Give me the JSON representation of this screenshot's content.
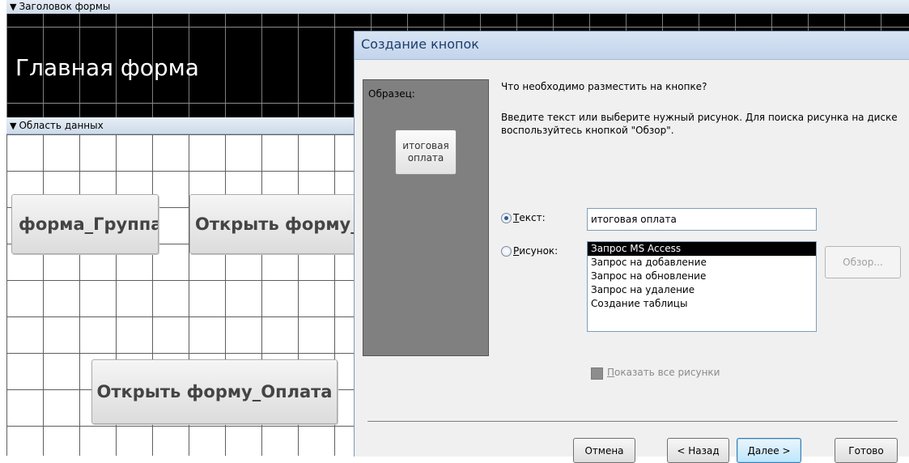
{
  "designer": {
    "header_section_label": "Заголовок формы",
    "form_title": "Главная форма",
    "detail_section_label": "Область данных",
    "buttons": [
      {
        "label": "форма_Группа"
      },
      {
        "label": "Открыть форму_С"
      },
      {
        "label": "Открыть форму_Оплата"
      }
    ]
  },
  "dialog": {
    "title": "Создание кнопок",
    "sample_label": "Образец:",
    "sample_button_label": "итоговая оплата",
    "question": "Что необходимо разместить на кнопке?",
    "instruction": "Введите текст или выберите нужный рисунок.  Для поиска рисунка на диске воспользуйтесь кнопкой \"Обзор\".",
    "text_option": {
      "hotkey": "Т",
      "rest": "екст:",
      "checked": true
    },
    "text_value": "итоговая оплата",
    "picture_option": {
      "hotkey": "Р",
      "rest": "исунок:",
      "checked": false
    },
    "picture_list": [
      "Запрос MS Access",
      "Запрос на добавление",
      "Запрос на обновление",
      "Запрос на удаление",
      "Создание таблицы"
    ],
    "picture_selected_index": 0,
    "browse_label": "Обзор...",
    "show_all": {
      "hotkey": "П",
      "rest": "оказать все рисунки"
    },
    "buttons": {
      "cancel": "Отмена",
      "back": "< Назад",
      "next": "Далее >",
      "finish": "Готово"
    }
  }
}
